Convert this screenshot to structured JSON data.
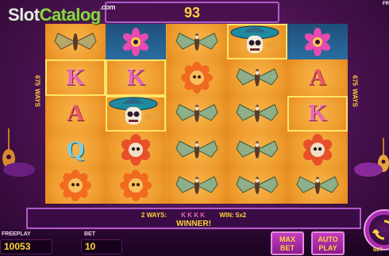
{
  "watermark": {
    "part1": "Slot",
    "part2": "Catalog",
    "part3": ".com"
  },
  "top": {
    "counter": "93",
    "corner_text": "FR"
  },
  "ways_label": {
    "number": "675",
    "word": "WAYS"
  },
  "reels": [
    [
      "butterfly-flower",
      "k",
      "a",
      "q",
      "orange-flower",
      "flower-teal"
    ],
    [
      "flower-teal",
      "k",
      "mariachi-skull",
      "skull-flower",
      "orange-flower",
      "flower-teal"
    ],
    [
      "moth",
      "orange-flower",
      "moth",
      "moth",
      "moth",
      "flower-purple"
    ],
    [
      "mariachi-skull",
      "moth",
      "moth",
      "moth",
      "moth",
      "flower-purple"
    ],
    [
      "flower-teal",
      "a",
      "k",
      "skull-flower",
      "moth",
      "flower-teal"
    ]
  ],
  "win": {
    "ways": "2 WAYS:",
    "symbols": "K K K K",
    "amount": "WIN: 5x2",
    "message": "WINNER!"
  },
  "bottom": {
    "freeplay_label": "FREEPLAY",
    "freeplay_value": "10053",
    "bet_label": "BET",
    "bet_value": "10"
  },
  "buttons": {
    "max_bet": [
      "MAX",
      "BET"
    ],
    "auto_play": [
      "AUTO",
      "PLAY"
    ],
    "bet_under_spin": "BET"
  },
  "colors": {
    "accent_gold": "#ffd23a",
    "panel_purple": "#3a0c45",
    "reel_orange": "#ee9a2c"
  }
}
